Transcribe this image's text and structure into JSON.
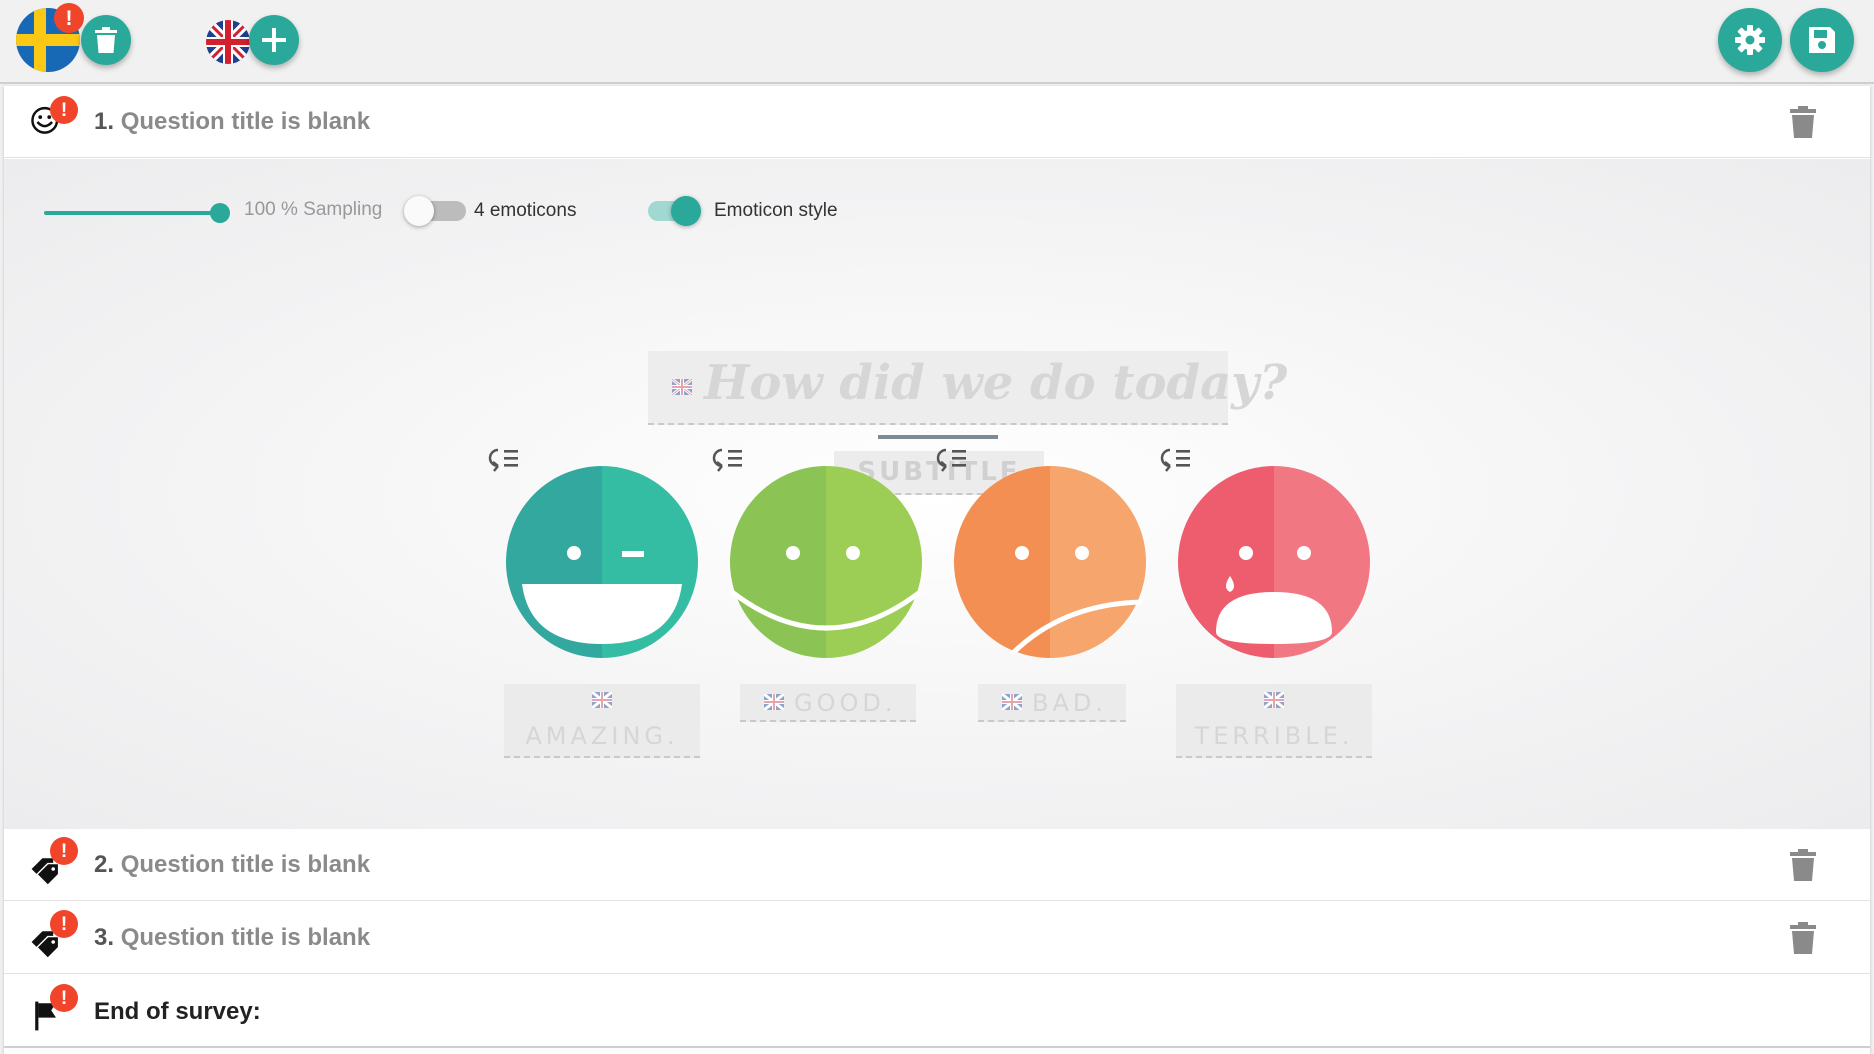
{
  "toolbar": {
    "primary_language": "Swedish",
    "secondary_language": "English",
    "delete_language_label": "Delete language",
    "add_language_label": "Add language",
    "settings_label": "Settings",
    "save_label": "Save",
    "accent_color": "#2aa89a",
    "warning_color": "#f0452a",
    "warning_glyph": "!"
  },
  "questions": [
    {
      "number": "1.",
      "title": "Question title is blank",
      "icon": "smiley-icon",
      "expanded": true
    },
    {
      "number": "2.",
      "title": "Question title is blank",
      "icon": "tags-icon",
      "expanded": false
    },
    {
      "number": "3.",
      "title": "Question title is blank",
      "icon": "tags-icon",
      "expanded": false
    }
  ],
  "end": {
    "title": "End of survey:",
    "icon": "flag-icon"
  },
  "editor": {
    "sampling_percent": 100,
    "sampling_label": "100 % Sampling",
    "four_emoticons_label": "4 emoticons",
    "four_emoticons_on": false,
    "emoticon_style_label": "Emoticon style",
    "emoticon_style_on": true,
    "question_placeholder": "How did we do today?",
    "subtitle_placeholder": "SUBTITLE",
    "emoticons": [
      {
        "label": "AMAZING.",
        "color_left": "#33a89e",
        "color_right": "#35bda3"
      },
      {
        "label": "GOOD.",
        "color_left": "#8bc454",
        "color_right": "#9ccd55"
      },
      {
        "label": "BAD.",
        "color_left": "#f38f52",
        "color_right": "#f6a56d"
      },
      {
        "label": "TERRIBLE.",
        "color_left": "#ee5d6e",
        "color_right": "#f17882"
      }
    ]
  }
}
